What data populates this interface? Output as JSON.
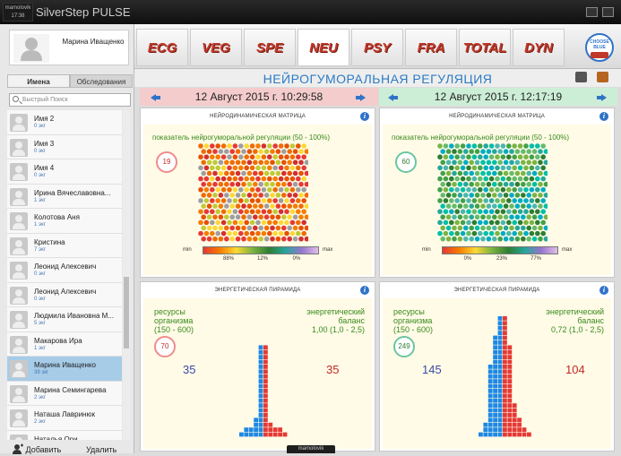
{
  "titlebar": {
    "badge_user": "mamolovik",
    "badge_time": "17:38",
    "title": "SilverStep PULSE"
  },
  "profile": {
    "name": "Марина Иващенко"
  },
  "sidebar": {
    "tabs": [
      "Имена",
      "Обследования"
    ],
    "search_placeholder": "Быстрый Поиск",
    "patients": [
      {
        "name": "Имя 2",
        "count": "0 экг"
      },
      {
        "name": "Имя 3",
        "count": "0 экг"
      },
      {
        "name": "Имя 4",
        "count": "0 экг"
      },
      {
        "name": "Ирина Вячеславовна...",
        "count": "1 экг"
      },
      {
        "name": "Колотова Аня",
        "count": "1 экг"
      },
      {
        "name": "Кристина",
        "count": "7 экг"
      },
      {
        "name": "Леонид Алексевич",
        "count": "0 экг"
      },
      {
        "name": "Леонид Алексевич",
        "count": "0 экг"
      },
      {
        "name": "Людмила Ивановна М...",
        "count": "5 экг"
      },
      {
        "name": "Макарова Ира",
        "count": "1 экг"
      },
      {
        "name": "Марина Иващенко",
        "count": "39 экг",
        "selected": true
      },
      {
        "name": "Марина Семингарева",
        "count": "2 экг"
      },
      {
        "name": "Наташа Лавринюк",
        "count": "2 экг"
      },
      {
        "name": "Наталья Ори...",
        "count": ""
      }
    ],
    "add_label": "Добавить",
    "delete_label": "Удалить"
  },
  "tabs": [
    {
      "label": "ECG"
    },
    {
      "label": "VEG"
    },
    {
      "label": "SPE"
    },
    {
      "label": "NEU",
      "active": true
    },
    {
      "label": "PSY"
    },
    {
      "label": "FRA"
    },
    {
      "label": "TOTAL"
    },
    {
      "label": "DYN"
    }
  ],
  "logo": {
    "text": "CHOOSE BLUE",
    "sub": "Мигалов"
  },
  "page": {
    "title": "НЕЙРОГУМОРАЛЬНАЯ РЕГУЛЯЦИЯ"
  },
  "left": {
    "date": "12 Август 2015 г. 10:29:58",
    "matrix": {
      "header": "НЕЙРОДИНАМИЧЕСКАЯ МАТРИЦА",
      "label": "показатель нейрогуморальной регуляции (50 - 100%)",
      "score": "19",
      "min": "min",
      "max": "max",
      "pcts": [
        "88%",
        "12%",
        "0%"
      ],
      "dominant": "red"
    },
    "pyramid": {
      "header": "ЭНЕРГЕТИЧЕСКАЯ ПИРАМИДА",
      "res_label": "ресурсы\nорганизма\n(150 - 600)",
      "bal_label": "энергетический\nбаланс\n1,00 (1,0 - 2,5)",
      "score": "70",
      "blue": "35",
      "red": "35"
    }
  },
  "right": {
    "date": "12 Август 2015 г. 12:17:19",
    "matrix": {
      "header": "НЕЙРОДИНАМИЧЕСКАЯ МАТРИЦА",
      "label": "показатель нейрогуморальной регуляции (50 - 100%)",
      "score": "60",
      "min": "min",
      "max": "max",
      "pcts": [
        "0%",
        "23%",
        "77%"
      ],
      "dominant": "green"
    },
    "pyramid": {
      "header": "ЭНЕРГЕТИЧЕСКАЯ ПИРАМИДА",
      "res_label": "ресурсы\nорганизма\n(150 - 600)",
      "bal_label": "энергетический\nбаланс\n0,72 (1,0 - 2,5)",
      "score": "249",
      "blue": "145",
      "red": "104"
    }
  },
  "bottom": {
    "label": "mamolovik"
  }
}
